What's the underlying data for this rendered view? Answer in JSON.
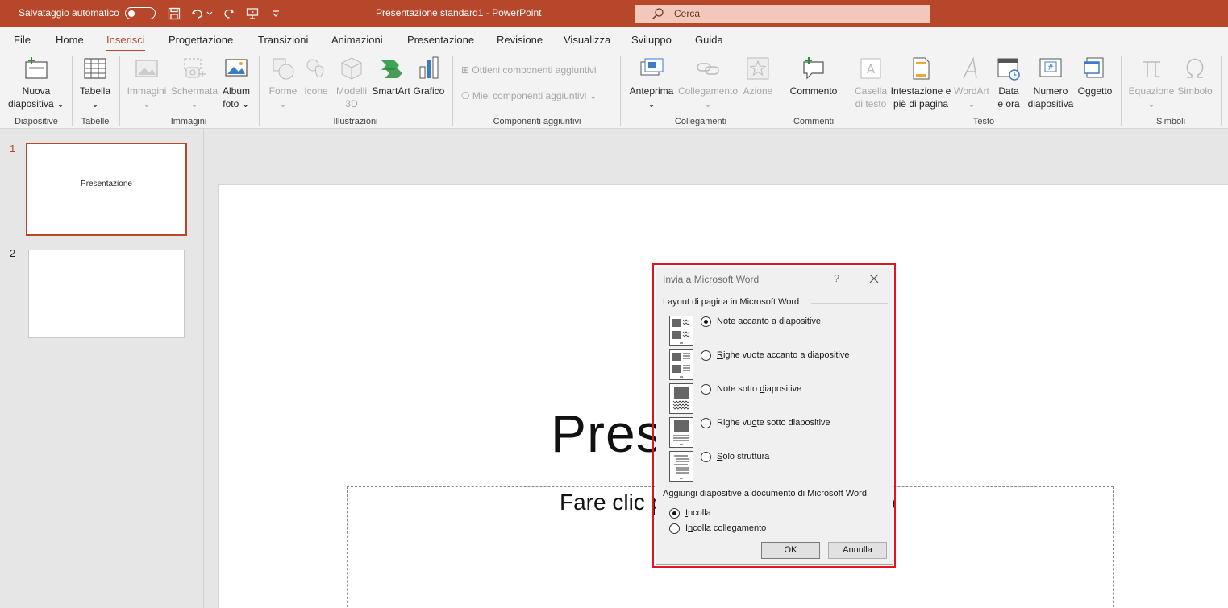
{
  "titlebar": {
    "autosave_label": "Salvataggio automatico",
    "document_title": "Presentazione standard1  -  PowerPoint",
    "search_placeholder": "Cerca"
  },
  "menu": {
    "tabs": [
      "File",
      "Home",
      "Inserisci",
      "Progettazione",
      "Transizioni",
      "Animazioni",
      "Presentazione",
      "Revisione",
      "Visualizza",
      "Sviluppo",
      "Guida"
    ],
    "active": "Inserisci"
  },
  "ribbon": {
    "nuova_diapositiva": [
      "Nuova",
      "diapositiva"
    ],
    "tabella": "Tabella",
    "immagini": "Immagini",
    "schermata": "Schermata",
    "album_foto": [
      "Album",
      "foto"
    ],
    "forme": "Forme",
    "icone": "Icone",
    "modelli_3d": [
      "Modelli",
      "3D"
    ],
    "smartart": "SmartArt",
    "grafico": "Grafico",
    "ottieni_componenti": "Ottieni componenti aggiuntivi",
    "miei_componenti": "Miei componenti aggiuntivi",
    "anteprima": "Anteprima",
    "collegamento": "Collegamento",
    "azione": "Azione",
    "commento": "Commento",
    "casella_testo": [
      "Casella",
      "di testo"
    ],
    "intestazione": [
      "Intestazione e",
      "piè di pagina"
    ],
    "wordart": "WordArt",
    "data_ora": [
      "Data",
      "e ora"
    ],
    "numero_diapositiva": [
      "Numero",
      "diapositiva"
    ],
    "oggetto": "Oggetto",
    "equazione": "Equazione",
    "simbolo": "Simbolo",
    "groups": {
      "diapositive": "Diapositive",
      "tabelle": "Tabelle",
      "immagini": "Immagini",
      "illustrazioni": "Illustrazioni",
      "componenti": "Componenti aggiuntivi",
      "collegamenti": "Collegamenti",
      "commenti": "Commenti",
      "testo": "Testo",
      "simboli": "Simboli"
    }
  },
  "thumbnails": [
    {
      "number": "1",
      "text": "Presentazione"
    },
    {
      "number": "2",
      "text": ""
    }
  ],
  "slide": {
    "title_left": "Pres",
    "title_right": "e",
    "subtitle_left": "Fare clic p",
    "subtitle_right": "o"
  },
  "dialog": {
    "title": "Invia a Microsoft Word",
    "help": "?",
    "layout_group": "Layout di pagina in Microsoft Word",
    "layout_options": [
      {
        "pre": "Note accanto a diapositi",
        "u": "v",
        "post": "e",
        "selected": true
      },
      {
        "pre": "",
        "u": "R",
        "post": "ighe vuote accanto a diapositive",
        "selected": false
      },
      {
        "pre": "Note sotto ",
        "u": "d",
        "post": "iapositive",
        "selected": false
      },
      {
        "pre": "Righe vu",
        "u": "o",
        "post": "te sotto diapositive",
        "selected": false
      },
      {
        "pre": "",
        "u": "S",
        "post": "olo struttura",
        "selected": false
      }
    ],
    "add_group": "Aggiungi diapositive a documento di Microsoft Word",
    "add_options": [
      {
        "pre": "",
        "u": "I",
        "post": "ncolla",
        "selected": true
      },
      {
        "pre": "I",
        "u": "n",
        "post": "colla collegamento",
        "selected": false
      }
    ],
    "ok_label": "OK",
    "cancel_label": "Annulla"
  }
}
